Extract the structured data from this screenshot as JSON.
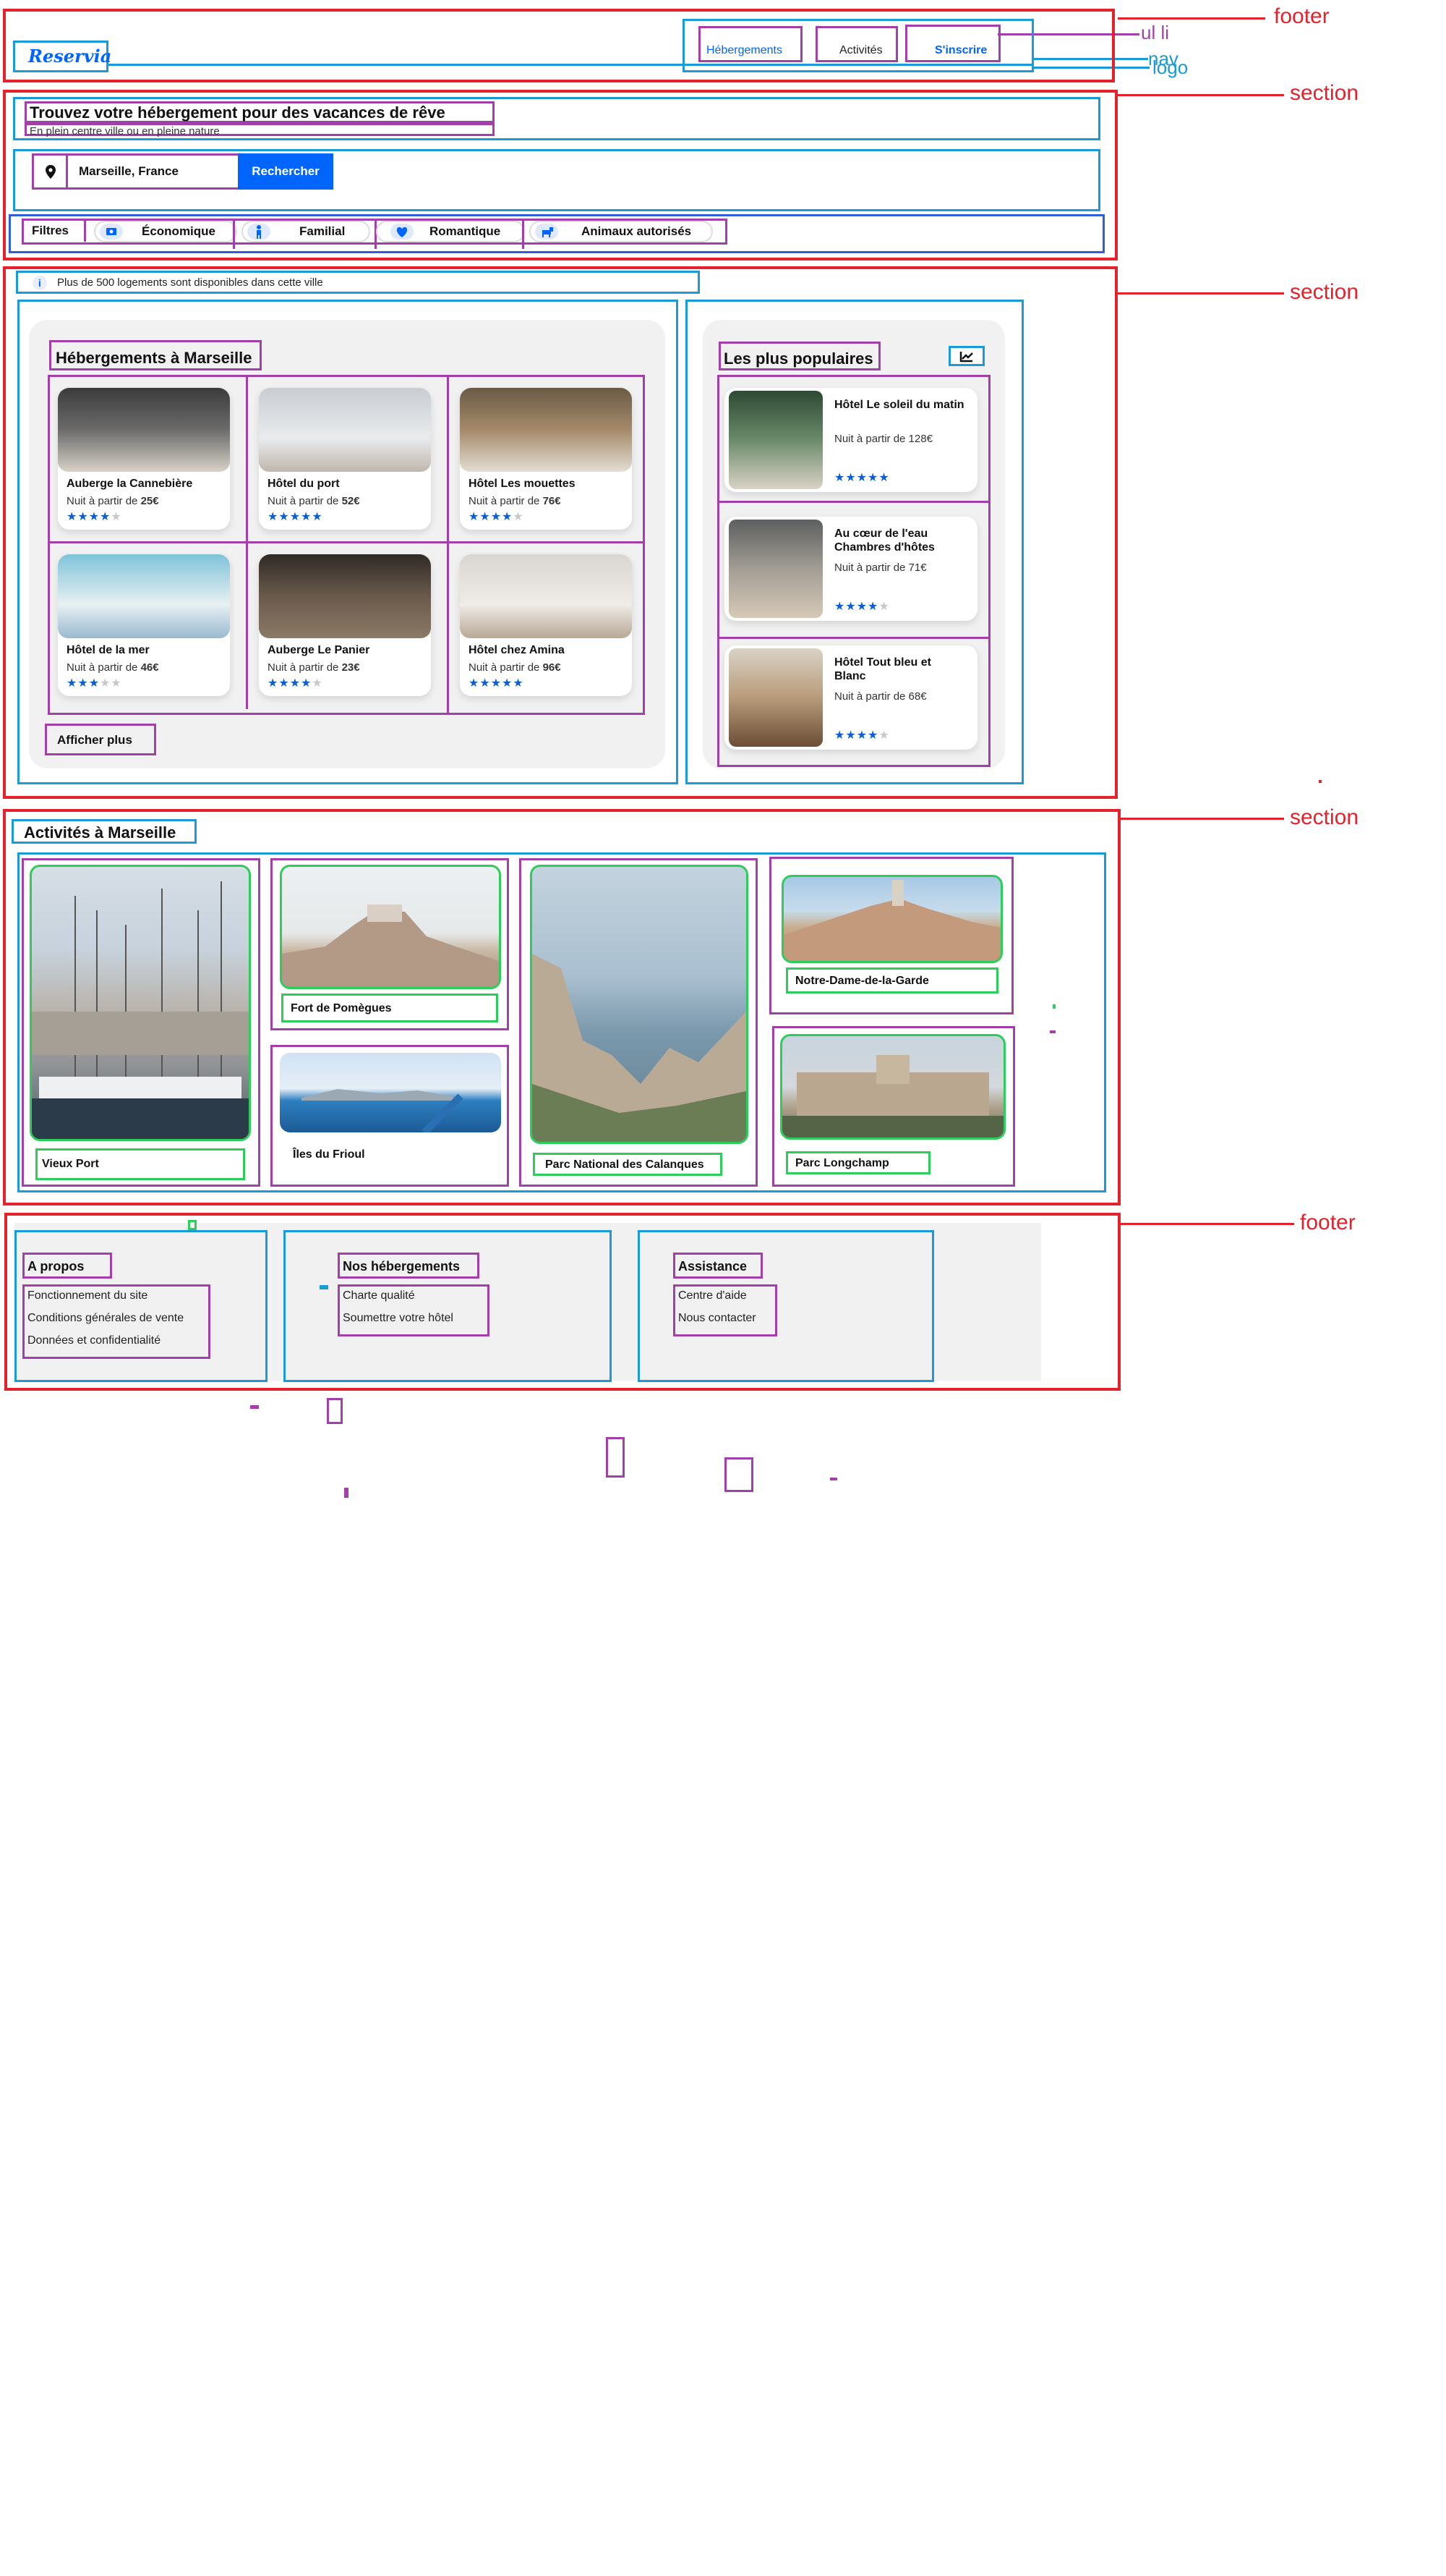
{
  "header": {
    "logo": "Reservia",
    "nav": [
      {
        "label": "Hébergements"
      },
      {
        "label": "Activités"
      },
      {
        "label": "S'inscrire"
      }
    ]
  },
  "annotations": {
    "footer_top": "footer",
    "ul_li": "ul li",
    "nav": "nav",
    "logo": "logo",
    "section1": "section",
    "section2": "section",
    "section3": "section",
    "footer_bottom": "footer"
  },
  "hero": {
    "title": "Trouvez votre hébergement pour des vacances de rêve",
    "subtitle": "En plein centre ville ou en pleine nature",
    "search_value": "Marseille, France",
    "search_button": "Rechercher"
  },
  "filters": {
    "label": "Filtres",
    "items": [
      {
        "label": "Économique",
        "icon": "money-icon"
      },
      {
        "label": "Familial",
        "icon": "child-icon"
      },
      {
        "label": "Romantique",
        "icon": "heart-icon"
      },
      {
        "label": "Animaux autorisés",
        "icon": "dog-icon"
      }
    ]
  },
  "info": "Plus de 500 logements sont disponibles dans cette ville",
  "accommodations": {
    "title": "Hébergements à Marseille",
    "price_prefix": "Nuit à partir de",
    "more_button": "Afficher plus",
    "items": [
      {
        "name": "Auberge la Cannebière",
        "price": "25€",
        "rating": 4
      },
      {
        "name": "Hôtel du port",
        "price": "52€",
        "rating": 5
      },
      {
        "name": "Hôtel Les mouettes",
        "price": "76€",
        "rating": 4
      },
      {
        "name": "Hôtel de la mer",
        "price": "46€",
        "rating": 3
      },
      {
        "name": "Auberge Le Panier",
        "price": "23€",
        "rating": 4
      },
      {
        "name": "Hôtel chez Amina",
        "price": "96€",
        "rating": 5
      }
    ]
  },
  "popular": {
    "title": "Les plus populaires",
    "icon": "trend-chart-icon",
    "items": [
      {
        "name": "Hôtel Le soleil du matin",
        "price_text": "Nuit à partir de 128€",
        "rating": 5
      },
      {
        "name": "Au cœur de l'eau Chambres d'hôtes",
        "price_text": "Nuit à partir de 71€",
        "rating": 4
      },
      {
        "name": "Hôtel Tout bleu et Blanc",
        "price_text": "Nuit à partir de 68€",
        "rating": 4
      }
    ]
  },
  "activities": {
    "title": "Activités à Marseille",
    "items": [
      "Vieux Port",
      "Fort de Pomègues",
      "Îles du Frioul",
      "Parc National des Calanques",
      "Notre-Dame-de-la-Garde",
      "Parc Longchamp"
    ]
  },
  "footer": {
    "columns": [
      {
        "title": "A propos",
        "links": [
          "Fonctionnement du site",
          "Conditions générales de vente",
          "Données et confidentialité"
        ]
      },
      {
        "title": "Nos hébergements",
        "links": [
          "Charte qualité",
          "Soumettre votre hôtel"
        ]
      },
      {
        "title": "Assistance",
        "links": [
          "Centre d'aide",
          "Nous contacter"
        ]
      }
    ]
  },
  "colors": {
    "accent": "#0065fc",
    "outline_red": "#e3222b",
    "outline_blue": "#1a9ad6",
    "outline_purple": "#a33fa8",
    "outline_green": "#2ecc5a"
  }
}
